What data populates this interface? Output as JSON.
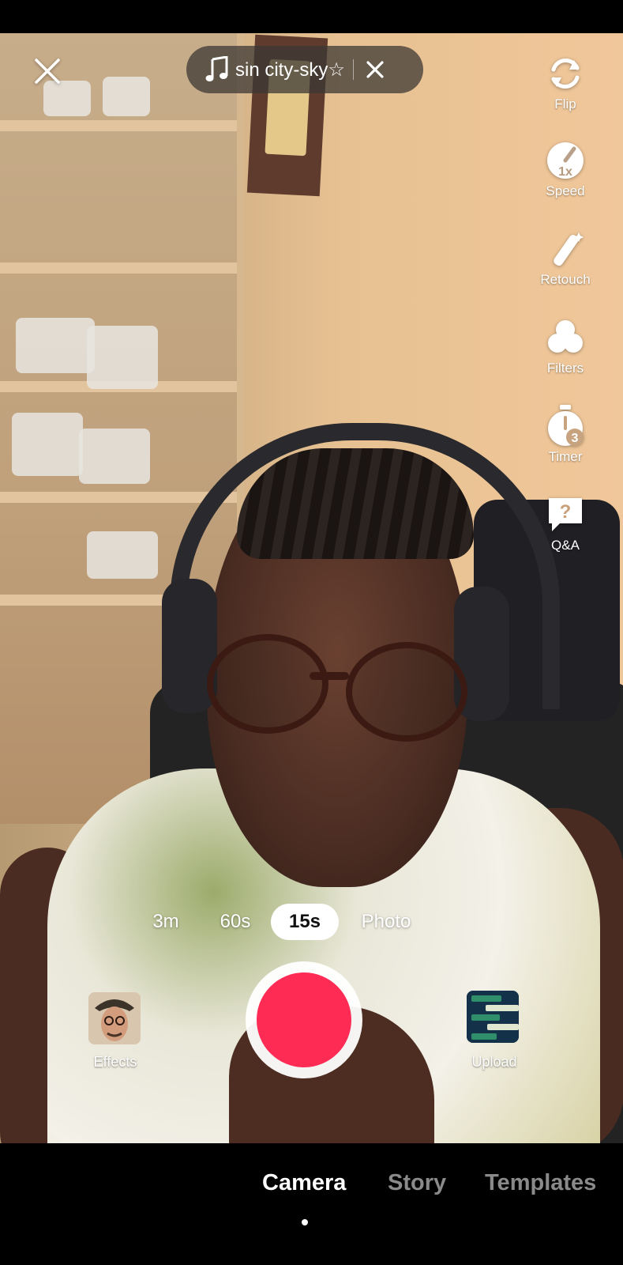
{
  "top": {
    "close_icon": "close-x",
    "sound": {
      "icon": "music-note",
      "title": "sin city-sky☆",
      "remove_icon": "close-x"
    }
  },
  "side_tools": [
    {
      "label": "Flip",
      "icon": "flip-camera"
    },
    {
      "label": "Speed",
      "icon": "speedometer",
      "badge": "1x"
    },
    {
      "label": "Retouch",
      "icon": "magic-wand"
    },
    {
      "label": "Filters",
      "icon": "filters-circles"
    },
    {
      "label": "Timer",
      "icon": "timer",
      "badge": "3"
    },
    {
      "label": "Q&A",
      "icon": "question-bubble",
      "badge": "?"
    }
  ],
  "durations": [
    {
      "label": "3m",
      "selected": false
    },
    {
      "label": "60s",
      "selected": false
    },
    {
      "label": "15s",
      "selected": true
    },
    {
      "label": "Photo",
      "selected": false
    }
  ],
  "capture": {
    "effects_label": "Effects",
    "upload_label": "Upload",
    "record_color": "#fe2c55"
  },
  "bottom_tabs": [
    {
      "label": "Camera",
      "active": true
    },
    {
      "label": "Story",
      "active": false
    },
    {
      "label": "Templates",
      "active": false
    }
  ]
}
